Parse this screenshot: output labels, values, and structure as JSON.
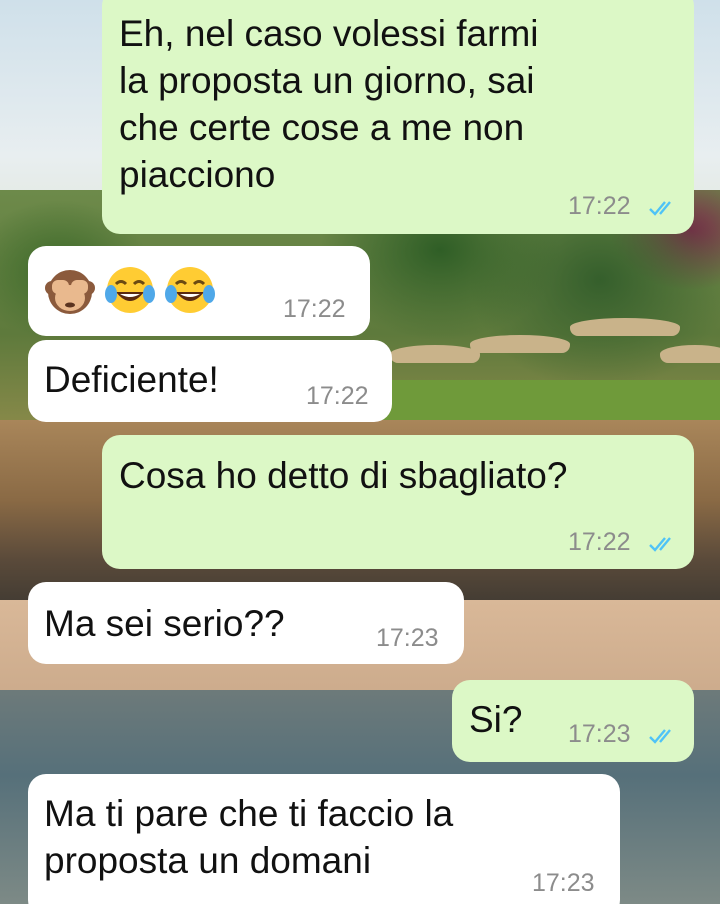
{
  "chat": {
    "messages": [
      {
        "direction": "outgoing",
        "text": "Eh, nel caso volessi farmi\nla proposta un giorno, sai\nche certe cose a me non\npiacciono",
        "time": "17:22",
        "status": "read"
      },
      {
        "direction": "incoming",
        "emoji": [
          "see-no-evil-monkey",
          "face-with-tears-of-joy",
          "face-with-tears-of-joy"
        ],
        "time": "17:22"
      },
      {
        "direction": "incoming",
        "text": "Deficiente!",
        "time": "17:22"
      },
      {
        "direction": "outgoing",
        "text": "Cosa ho detto di sbagliato?",
        "time": "17:22",
        "status": "read"
      },
      {
        "direction": "incoming",
        "text": "Ma sei serio??",
        "time": "17:23"
      },
      {
        "direction": "outgoing",
        "text": "Si?",
        "time": "17:23",
        "status": "read"
      },
      {
        "direction": "incoming",
        "text": "Ma ti pare che ti faccio la\nproposta un domani",
        "time": "17:23"
      }
    ]
  },
  "colors": {
    "outgoing_bubble": "#dcf8c6",
    "incoming_bubble": "#ffffff",
    "read_ticks": "#4fc3f7",
    "time_text": "#8c8c8c"
  }
}
